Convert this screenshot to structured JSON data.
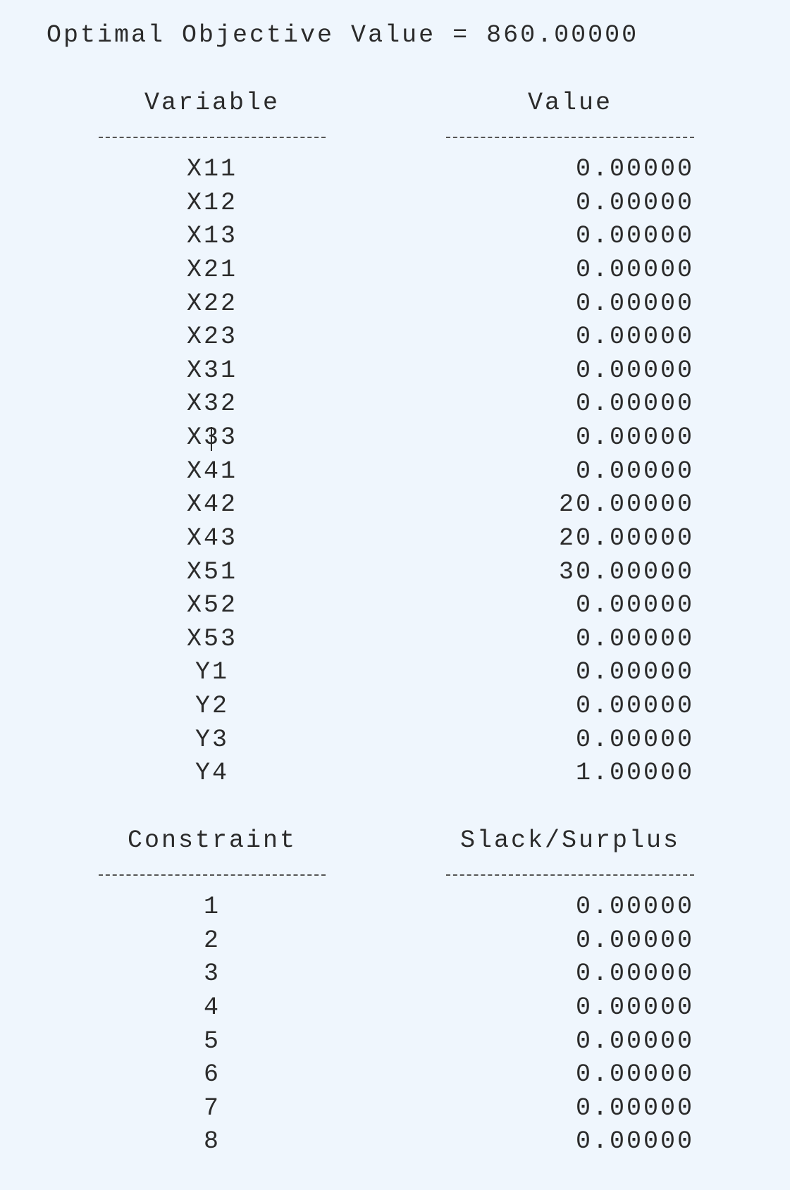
{
  "title": "Optimal Objective Value = 860.00000",
  "variables_section": {
    "header_left": "Variable",
    "header_right": "Value",
    "rows": [
      {
        "name": "X11",
        "value": "0.00000"
      },
      {
        "name": "X12",
        "value": "0.00000"
      },
      {
        "name": "X13",
        "value": "0.00000"
      },
      {
        "name": "X21",
        "value": "0.00000"
      },
      {
        "name": "X22",
        "value": "0.00000"
      },
      {
        "name": "X23",
        "value": "0.00000"
      },
      {
        "name": "X31",
        "value": "0.00000"
      },
      {
        "name": "X32",
        "value": "0.00000"
      },
      {
        "name": "X33",
        "value": "0.00000"
      },
      {
        "name": "X41",
        "value": "0.00000"
      },
      {
        "name": "X42",
        "value": "20.00000"
      },
      {
        "name": "X43",
        "value": "20.00000"
      },
      {
        "name": "X51",
        "value": "30.00000"
      },
      {
        "name": "X52",
        "value": "0.00000"
      },
      {
        "name": "X53",
        "value": "0.00000"
      },
      {
        "name": "Y1",
        "value": "0.00000"
      },
      {
        "name": "Y2",
        "value": "0.00000"
      },
      {
        "name": "Y3",
        "value": "0.00000"
      },
      {
        "name": "Y4",
        "value": "1.00000"
      }
    ]
  },
  "constraints_section": {
    "header_left": "Constraint",
    "header_right": "Slack/Surplus",
    "rows": [
      {
        "name": "1",
        "value": "0.00000"
      },
      {
        "name": "2",
        "value": "0.00000"
      },
      {
        "name": "3",
        "value": "0.00000"
      },
      {
        "name": "4",
        "value": "0.00000"
      },
      {
        "name": "5",
        "value": "0.00000"
      },
      {
        "name": "6",
        "value": "0.00000"
      },
      {
        "name": "7",
        "value": "0.00000"
      },
      {
        "name": "8",
        "value": "0.00000"
      }
    ]
  }
}
